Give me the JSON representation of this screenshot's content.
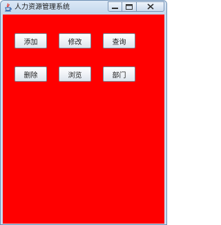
{
  "window": {
    "title": "人力资源管理系统"
  },
  "controls": {
    "minimize_icon": "minimize-icon",
    "maximize_icon": "maximize-icon",
    "close_icon": "close-icon"
  },
  "panel": {
    "background_color": "#ff0000"
  },
  "buttons": {
    "add": "添加",
    "modify": "修改",
    "query": "查询",
    "delete": "删除",
    "browse": "浏览",
    "department": "部门"
  }
}
